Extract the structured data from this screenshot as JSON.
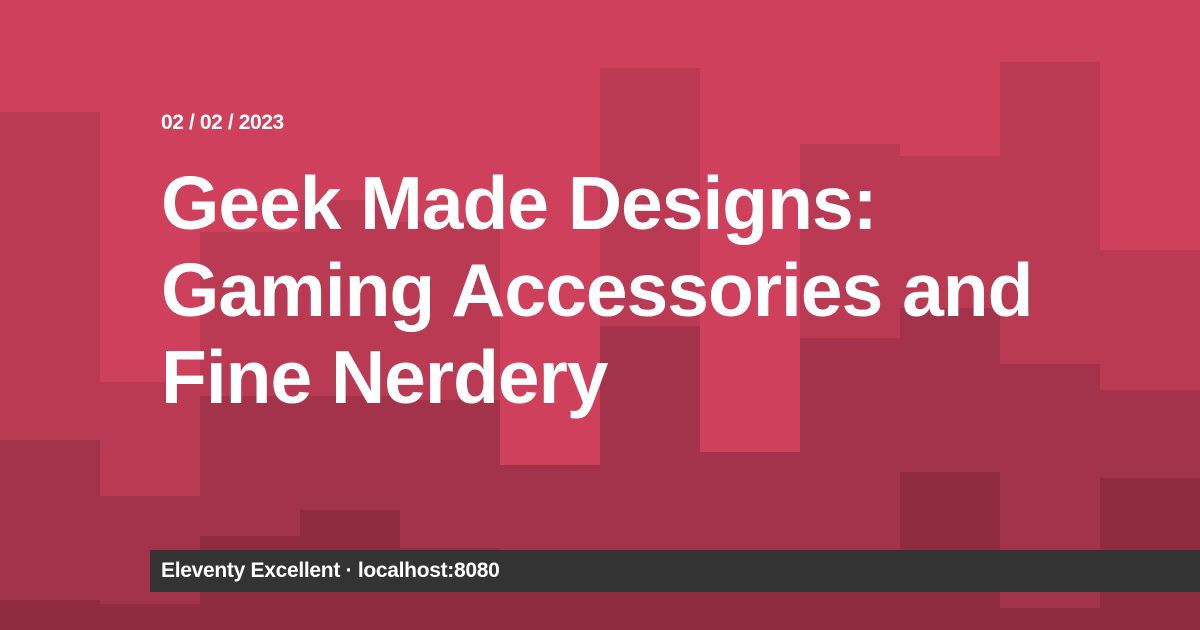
{
  "post": {
    "date": "02 / 02 / 2023",
    "title": "Geek Made Designs: Gaming Accessories and Fine Nerdery"
  },
  "footer": {
    "site_name": "Eleventy Excellent",
    "separator": "·",
    "host": "localhost:8080"
  },
  "colors": {
    "background": "#cf405c",
    "footer_background": "#333333",
    "text": "#ffffff"
  }
}
